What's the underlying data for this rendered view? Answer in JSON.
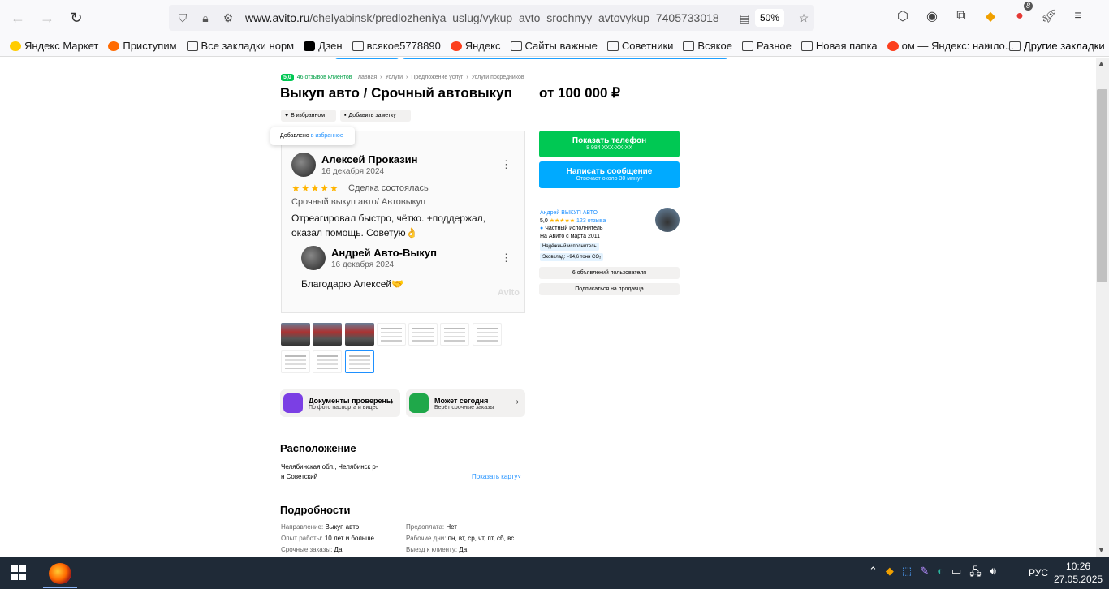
{
  "browser": {
    "url_prefix": "www.avito.ru",
    "url_path": "/chelyabinsk/predlozheniya_uslug/vykup_avto_srochnyy_avtovykup_7405733018",
    "zoom": "50%",
    "extension_badge": "8",
    "avatar_label": "АВР"
  },
  "bookmarks": {
    "items": [
      {
        "label": "Яндекс Маркет",
        "icon": "yandex-market-icon"
      },
      {
        "label": "Приступим",
        "icon": "firefox-icon"
      },
      {
        "label": "Все закладки норм",
        "icon": "folder-icon"
      },
      {
        "label": "Дзен",
        "icon": "dzen-icon"
      },
      {
        "label": "всякое5778890",
        "icon": "folder-icon"
      },
      {
        "label": "Яндекс",
        "icon": "yandex-icon"
      },
      {
        "label": "Сайты важные",
        "icon": "folder-icon"
      },
      {
        "label": "Советники",
        "icon": "folder-icon"
      },
      {
        "label": "Всякое",
        "icon": "folder-icon"
      },
      {
        "label": "Разное",
        "icon": "folder-icon"
      },
      {
        "label": "Новая папка",
        "icon": "folder-icon"
      },
      {
        "label": "ом — Яндекс: нашло...",
        "icon": "yandex-icon"
      }
    ],
    "other": "Другие закладки"
  },
  "page": {
    "rating": "5,0",
    "reviews_link": "46 отзывов клиентов",
    "breadcrumbs": [
      "Главная",
      "Услуги",
      "Предложение услуг",
      "Услуги посредников"
    ],
    "title": "Выкуп авто / Срочный автовыкуп",
    "price": "от 100 000 ₽",
    "fav_button": "В избранном",
    "note_button": "Добавить заметку",
    "tooltip_text": "Добавлено",
    "tooltip_link": "в избранное",
    "review": {
      "author": "Алексей Проказин",
      "date": "16 декабря 2024",
      "stars": "★★★★★",
      "deal": "Сделка состоялась",
      "item": "Срочный выкуп авто/ Автовыкуп",
      "text1": "Отреагировал быстро, чётко. +поддержал,",
      "text2": "оказал помощь. Советую👌",
      "reply_author": "Андрей Авто-Выкуп",
      "reply_date": "16 декабря 2024",
      "reply_text": "Благодарю Алексей🤝",
      "watermark": "Avito"
    },
    "features": [
      {
        "title": "Документы проверены",
        "subtitle": "По фото паспорта и видео"
      },
      {
        "title": "Может сегодня",
        "subtitle": "Берёт срочные заказы"
      }
    ],
    "location_heading": "Расположение",
    "address": "Челябинская обл., Челябинск р-н Советский",
    "show_map": "Показать карту˅",
    "details_heading": "Подробности",
    "details": [
      {
        "k": "Направление:",
        "v": "Выкуп авто"
      },
      {
        "k": "Предоплата:",
        "v": "Нет"
      },
      {
        "k": "Опыт работы:",
        "v": "10 лет и больше"
      },
      {
        "k": "Рабочие дни:",
        "v": "пн, вт, ср, чт, пт, сб, вс"
      },
      {
        "k": "Срочные заказы:",
        "v": "Да"
      },
      {
        "k": "Выезд к клиенту:",
        "v": "Да"
      }
    ],
    "call_button": "Показать телефон",
    "call_sub": "8 984 XXX-XX-XX",
    "msg_button": "Написать сообщение",
    "msg_sub": "Отвечает около 30 минут",
    "seller": {
      "name": "Андрей ВЫКУП АВТО",
      "rating": "5,0",
      "stars": "★★★★★",
      "reviews": "123 отзыва",
      "type": "Частный исполнитель",
      "since": "На Авито с марта 2011",
      "tag1": "Надёжный исполнитель",
      "tag2": "Эковклад: −94,6 тонн CO₂"
    },
    "listings_button": "6 объявлений пользователя",
    "subscribe_button": "Подписаться на продавца"
  },
  "taskbar": {
    "lang": "РУС",
    "time": "10:26",
    "date": "27.05.2025"
  }
}
